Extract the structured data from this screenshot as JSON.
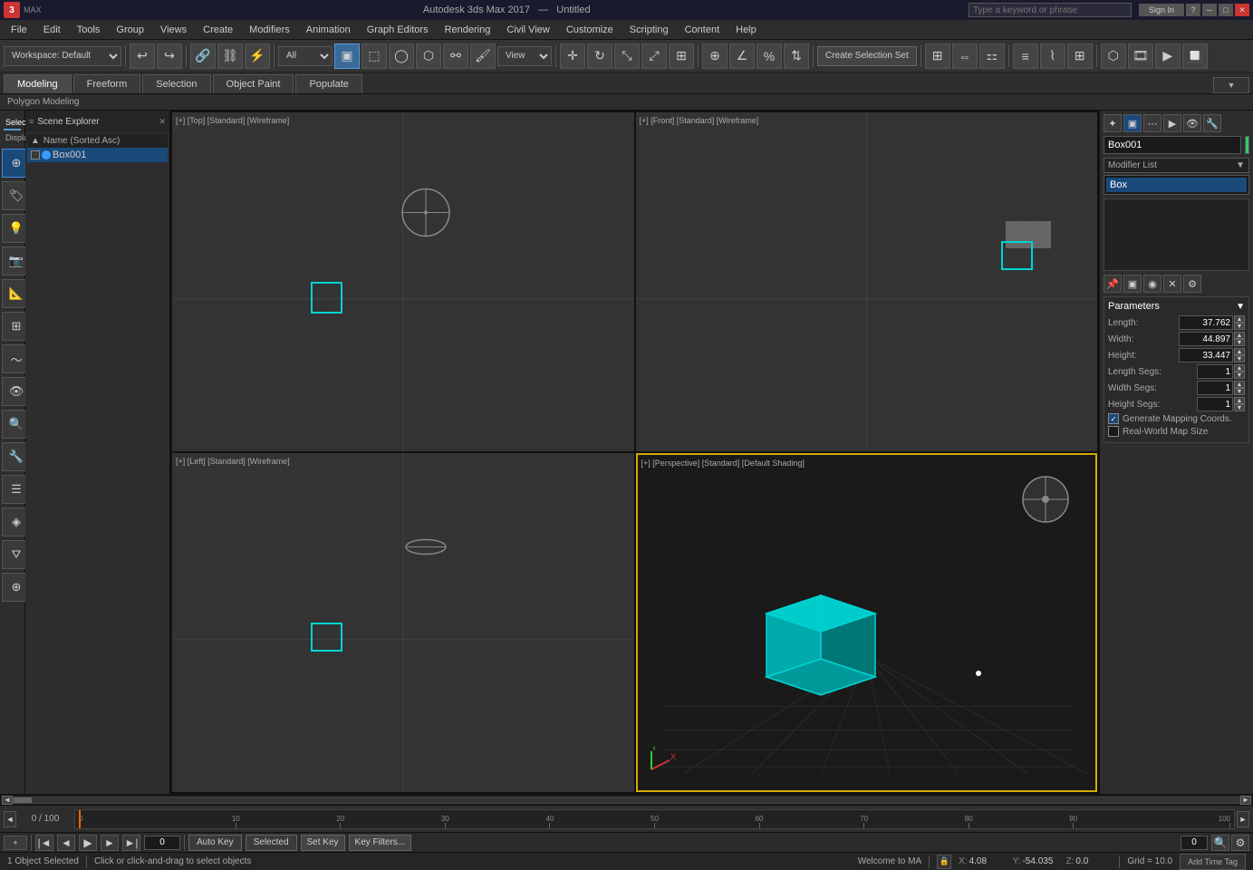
{
  "titlebar": {
    "app": "3",
    "app_label": "MAX",
    "software": "Autodesk 3ds Max 2017",
    "filename": "Untitled",
    "search_placeholder": "Type a keyword or phrase",
    "sign_in": "Sign In",
    "help": "?"
  },
  "menubar": {
    "items": [
      "File",
      "Edit",
      "Tools",
      "Group",
      "Views",
      "Create",
      "Modifiers",
      "Animation",
      "Graph Editors",
      "Rendering",
      "Civil View",
      "Customize",
      "Scripting",
      "Content",
      "Help"
    ]
  },
  "toolbar": {
    "workspace_label": "Workspace: Default",
    "selection_filter": "All",
    "create_selection_set": "Create Selection Set",
    "icon_titles": [
      "undo",
      "redo",
      "select-link",
      "unlink",
      "bind-space-warp",
      "selection-filter",
      "select",
      "select-region",
      "fence",
      "lasso",
      "paint",
      "move",
      "rotate",
      "scale",
      "scale-non-uniform",
      "place",
      "snap-toggle",
      "angle-snap",
      "percent-snap",
      "spinner-snap",
      "edit-named-selections",
      "mirror",
      "align",
      "layer-manager",
      "curve-editor",
      "schematic-view",
      "material-editor",
      "render-setup",
      "render",
      "render-frame"
    ]
  },
  "tabs": {
    "items": [
      "Modeling",
      "Freeform",
      "Selection",
      "Object Paint",
      "Populate"
    ],
    "active": "Modeling"
  },
  "subtabs": {
    "items": [
      "Select",
      "Display"
    ],
    "active": "Select"
  },
  "breadcrumb": "Polygon Modeling",
  "scene_panel": {
    "col_header": "Name (Sorted Asc)",
    "items": [
      {
        "name": "Box001",
        "visible": true,
        "color": "#3a9aff"
      }
    ]
  },
  "viewports": {
    "top": {
      "label": "[+] [Top] [Standard] [Wireframe]"
    },
    "front": {
      "label": "[+] [Front] [Standard] [Wireframe]"
    },
    "left": {
      "label": "[+] [Left] [Standard] [Wireframe]"
    },
    "perspective": {
      "label": "[+] [Perspective] [Standard] [Default Shading]",
      "active": true
    }
  },
  "right_panel": {
    "object_name": "Box001",
    "color": "#33cc66",
    "modifier_list_label": "Modifier List",
    "modifier_stack": [
      "Box"
    ],
    "selected_modifier": "Box",
    "params": {
      "title": "Parameters",
      "length_label": "Length:",
      "length_val": "37.762",
      "width_label": "Width:",
      "width_val": "44.897",
      "height_label": "Height:",
      "height_val": "33.447",
      "length_segs_label": "Length Segs:",
      "length_segs_val": "1",
      "width_segs_label": "Width Segs:",
      "width_segs_val": "1",
      "height_segs_label": "Height Segs:",
      "height_segs_val": "1",
      "gen_mapping": "Generate Mapping Coords.",
      "real_world": "Real-World Map Size"
    }
  },
  "timeline": {
    "position": "0 / 100",
    "ticks": [
      "0",
      "10",
      "20",
      "30",
      "40",
      "50",
      "60",
      "70",
      "80",
      "90",
      "100"
    ]
  },
  "anim_bar": {
    "auto_key": "Auto Key",
    "selected_label": "Selected",
    "set_key": "Set Key",
    "key_filters": "Key Filters...",
    "counter": "0"
  },
  "status_bar": {
    "objects_selected": "1 Object Selected",
    "hint": "Click or click-and-drag to select objects",
    "welcome": "Welcome to MA",
    "x_label": "X:",
    "x_val": "4.08",
    "y_label": "Y:",
    "y_val": "-54.035",
    "z_label": "Z:",
    "z_val": "0.0",
    "grid_label": "Grid = 10.0",
    "add_time_tag": "Add Time Tag"
  }
}
